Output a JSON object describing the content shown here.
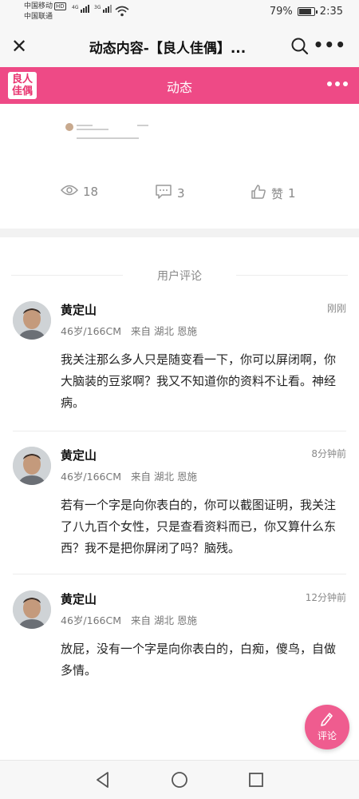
{
  "status_bar": {
    "carrier1": "中国移动",
    "hd_badge": "HD",
    "carrier2": "中国联通",
    "net1": "4G",
    "net2": "3G",
    "battery": "79%",
    "time": "2:35"
  },
  "titlebar": {
    "title": "动态内容-【良人佳偶】...",
    "close_icon": "close-icon",
    "search_icon": "search-icon",
    "more_icon": "more-dots-icon"
  },
  "header": {
    "logo_text_line1": "良人",
    "logo_text_line2": "佳偶",
    "title": "动态",
    "brand_color": "#ee4a86"
  },
  "post": {
    "views": "18",
    "comments": "3",
    "likes_label": "赞",
    "likes": "1"
  },
  "comments_section": {
    "title": "用户评论",
    "items": [
      {
        "name": "黄定山",
        "time": "刚刚",
        "age_height": "46岁/166CM",
        "location": "来自 湖北 恩施",
        "text": "我关注那么多人只是随变看一下，你可以屏闭啊，你大脑装的豆浆啊？我又不知道你的资料不让看。神经病。"
      },
      {
        "name": "黄定山",
        "time": "8分钟前",
        "age_height": "46岁/166CM",
        "location": "来自 湖北 恩施",
        "text": "若有一个字是向你表白的，你可以截图证明，我关注了八九百个女性，只是查看资料而已，你又算什么东西？我不是把你屏闭了吗？脑残。"
      },
      {
        "name": "黄定山",
        "time": "12分钟前",
        "age_height": "46岁/166CM",
        "location": "来自 湖北 恩施",
        "text": "放屁，没有一个字是向你表白的，白痴，傻鸟，自做多情。"
      }
    ]
  },
  "fab": {
    "label": "评论"
  }
}
